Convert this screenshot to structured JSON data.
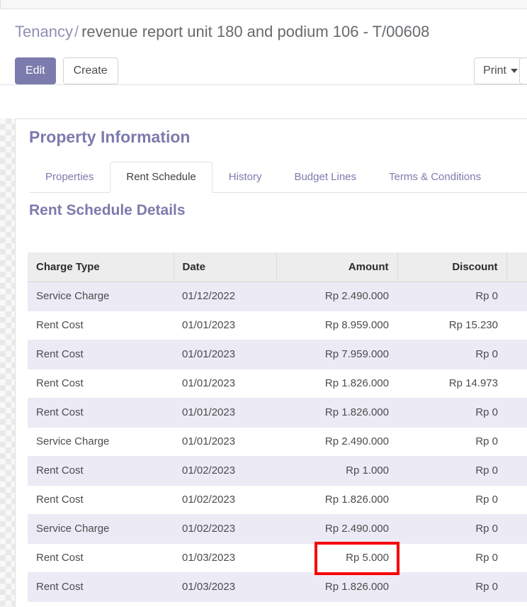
{
  "breadcrumb": {
    "root": "Tenancy",
    "separator": "/",
    "current": "revenue report unit 180 and podium 106 - T/00608"
  },
  "toolbar": {
    "edit_label": "Edit",
    "create_label": "Create",
    "print_label": "Print"
  },
  "sheet": {
    "section_title": "Property Information",
    "subsection_title": "Rent Schedule Details"
  },
  "tabs": [
    {
      "label": "Properties",
      "active": false
    },
    {
      "label": "Rent Schedule",
      "active": true
    },
    {
      "label": "History",
      "active": false
    },
    {
      "label": "Budget Lines",
      "active": false
    },
    {
      "label": "Terms & Conditions",
      "active": false
    }
  ],
  "table": {
    "columns": [
      "Charge Type",
      "Date",
      "Amount",
      "Discount",
      ""
    ],
    "rows": [
      {
        "charge_type": "Service Charge",
        "date": "01/12/2022",
        "amount": "Rp 2.490.000",
        "discount": "Rp 0"
      },
      {
        "charge_type": "Rent Cost",
        "date": "01/01/2023",
        "amount": "Rp 8.959.000",
        "discount": "Rp 15.230"
      },
      {
        "charge_type": "Rent Cost",
        "date": "01/01/2023",
        "amount": "Rp 7.959.000",
        "discount": "Rp 0"
      },
      {
        "charge_type": "Rent Cost",
        "date": "01/01/2023",
        "amount": "Rp 1.826.000",
        "discount": "Rp 14.973"
      },
      {
        "charge_type": "Rent Cost",
        "date": "01/01/2023",
        "amount": "Rp 1.826.000",
        "discount": "Rp 0"
      },
      {
        "charge_type": "Service Charge",
        "date": "01/01/2023",
        "amount": "Rp 2.490.000",
        "discount": "Rp 0"
      },
      {
        "charge_type": "Rent Cost",
        "date": "01/02/2023",
        "amount": "Rp 1.000",
        "discount": "Rp 0"
      },
      {
        "charge_type": "Rent Cost",
        "date": "01/02/2023",
        "amount": "Rp 1.826.000",
        "discount": "Rp 0"
      },
      {
        "charge_type": "Service Charge",
        "date": "01/02/2023",
        "amount": "Rp 2.490.000",
        "discount": "Rp 0"
      },
      {
        "charge_type": "Rent Cost",
        "date": "01/03/2023",
        "amount": "Rp 5.000",
        "discount": "Rp 0"
      },
      {
        "charge_type": "Rent Cost",
        "date": "01/03/2023",
        "amount": "Rp 1.826.000",
        "discount": "Rp 0"
      }
    ]
  },
  "annotation": {
    "highlight_color": "#f60000",
    "highlighted_value": "Rp 5.000"
  },
  "colors": {
    "accent": "#7c7bad",
    "breadcrumb_link": "#8f8fb5",
    "row_stripe": "#eceaf5",
    "header_bg": "#ededed"
  }
}
